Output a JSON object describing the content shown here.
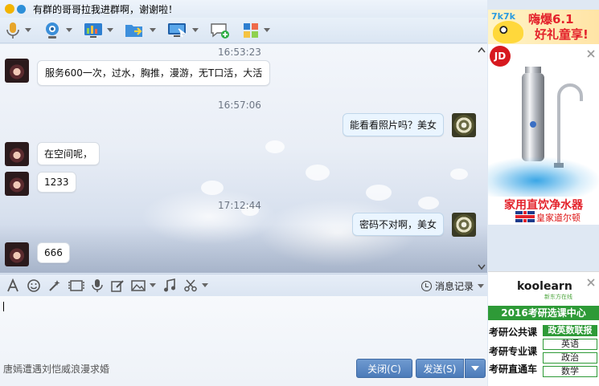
{
  "window": {
    "title": "有群的哥哥拉我进群啊，谢谢啦！"
  },
  "chat": {
    "messages": [
      {
        "type": "time",
        "text": "16:53:23"
      },
      {
        "type": "msg",
        "side": "left",
        "text": "服务600一次，过水，胸推，漫游，无T口活，大活"
      },
      {
        "type": "time",
        "text": "16:57:06"
      },
      {
        "type": "msg",
        "side": "right",
        "text": "能看看照片吗？美女"
      },
      {
        "type": "msg",
        "side": "left",
        "text": "在空间呢，"
      },
      {
        "type": "msg",
        "side": "left",
        "text": "1233"
      },
      {
        "type": "time",
        "text": "17:12:44"
      },
      {
        "type": "msg",
        "side": "right",
        "text": "密码不对啊，美女"
      },
      {
        "type": "msg",
        "side": "left",
        "text": "666"
      }
    ]
  },
  "input": {
    "history_label": "消息记录",
    "ad_text": "唐嫣遭遇刘恺威浪漫求婚",
    "close_label": "关闭(C)",
    "send_label": "发送(S)"
  },
  "ads": {
    "ad1": {
      "logo": "7k7k",
      "line1": "嗨爆6.1",
      "line2": "好礼童享!"
    },
    "ad2": {
      "logo": "JD",
      "line1": "家用直饮净水器",
      "line2": "皇家道尔顿"
    },
    "ad3": {
      "brand": "koolearn",
      "sub": "新东方在线",
      "banner": "2016考研选课中心",
      "rows": [
        "考研公共课",
        "考研专业课",
        "考研直通车"
      ],
      "tags": [
        "政英数联报",
        "英语",
        "政治",
        "数学"
      ]
    }
  },
  "colors": {
    "accent": "#4c7bb9",
    "ad_green": "#2e9a37",
    "ad_red": "#e3222b"
  }
}
